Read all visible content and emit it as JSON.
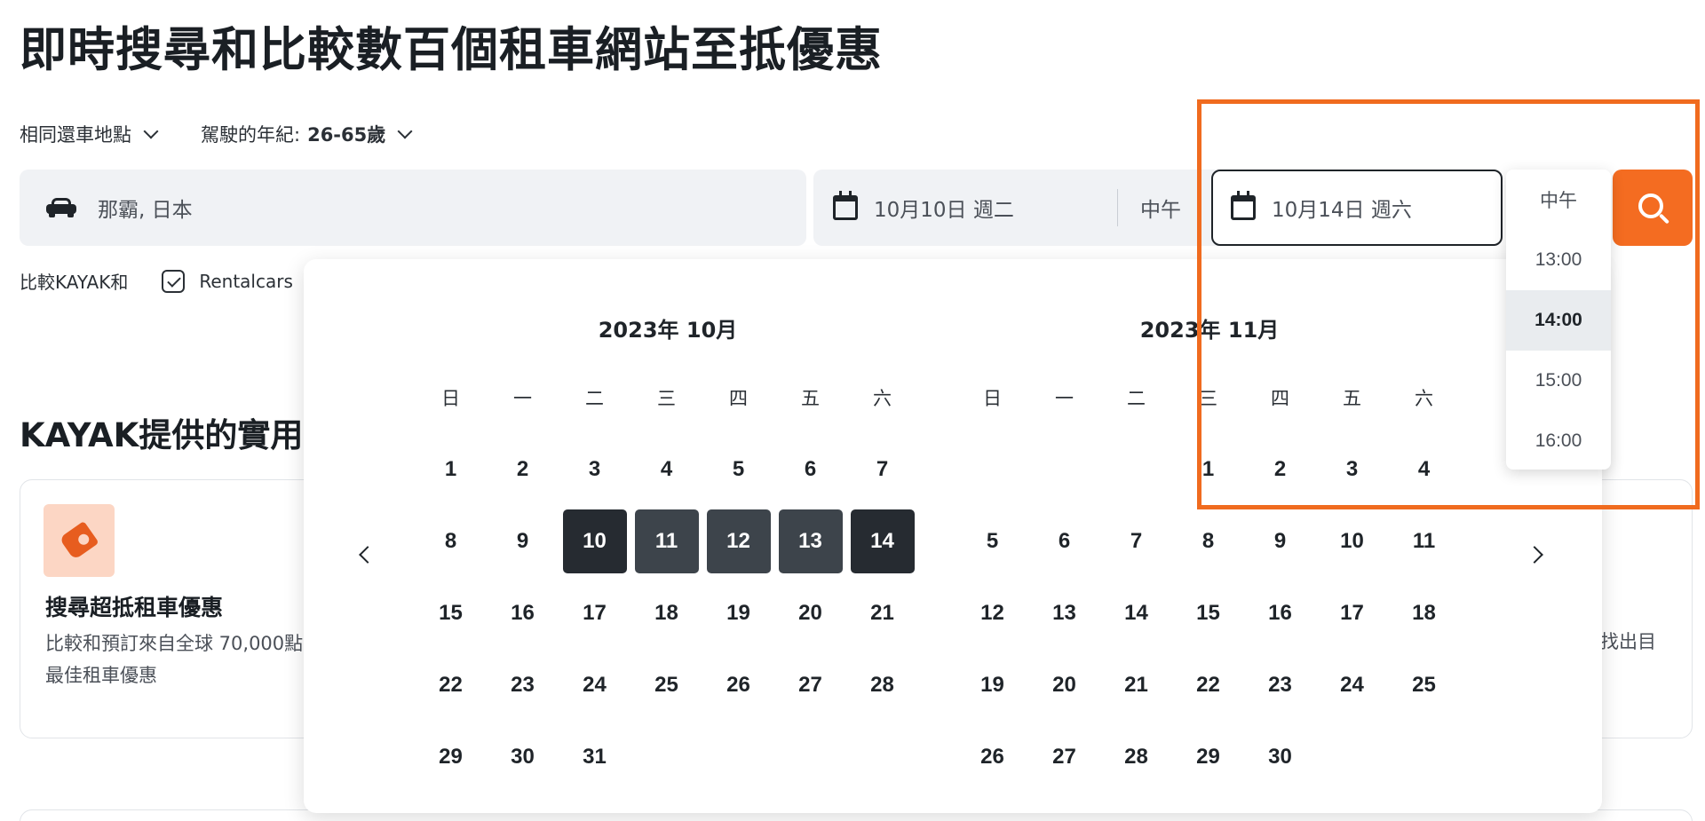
{
  "headline": "即時搜尋和比較數百個租車網站至抵優惠",
  "options": {
    "return_location": "相同還車地點",
    "driver_age_label": "駕駛的年紀:",
    "driver_age_value": "26-65歲"
  },
  "search": {
    "location": "那霸, 日本",
    "pickup_date": "10月10日 週二",
    "pickup_time": "中午",
    "return_date": "10月14日 週六"
  },
  "compare": {
    "label": "比較KAYAK和",
    "partner": "Rentalcars"
  },
  "section_title": "KAYAK提供的實用",
  "card": {
    "title": "搜尋超抵租車優惠",
    "desc": "比較和預訂來自全球 70,000點的最佳租車優惠",
    "right_fragment": "找出目"
  },
  "calendar": {
    "weekdays": [
      "日",
      "一",
      "二",
      "三",
      "四",
      "五",
      "六"
    ],
    "months": [
      {
        "title": "2023年 10月",
        "offset": 0,
        "days": [
          "1",
          "2",
          "3",
          "4",
          "5",
          "6",
          "7",
          "8",
          "9",
          "10",
          "11",
          "12",
          "13",
          "14",
          "15",
          "16",
          "17",
          "18",
          "19",
          "20",
          "21",
          "22",
          "23",
          "24",
          "25",
          "26",
          "27",
          "28",
          "29",
          "30",
          "31"
        ]
      },
      {
        "title": "2023年 11月",
        "offset": 3,
        "days": [
          "1",
          "2",
          "3",
          "4",
          "5",
          "6",
          "7",
          "8",
          "9",
          "10",
          "11",
          "12",
          "13",
          "14",
          "15",
          "16",
          "17",
          "18",
          "19",
          "20",
          "21",
          "22",
          "23",
          "24",
          "25",
          "26",
          "27",
          "28",
          "29",
          "30"
        ]
      }
    ],
    "selected_start": "10",
    "selected_end": "14",
    "range_days": [
      "11",
      "12",
      "13"
    ]
  },
  "time_options": [
    "中午",
    "13:00",
    "14:00",
    "15:00",
    "16:00"
  ],
  "time_selected": "14:00",
  "colors": {
    "accent": "#f46c21",
    "highlight_frame": "#f06b1f",
    "selected_day": "#262b31",
    "range_day": "#3d444b"
  },
  "icons": {
    "location": "car-icon",
    "date": "calendar-icon",
    "search": "search-icon",
    "card": "price-tag-icon"
  }
}
